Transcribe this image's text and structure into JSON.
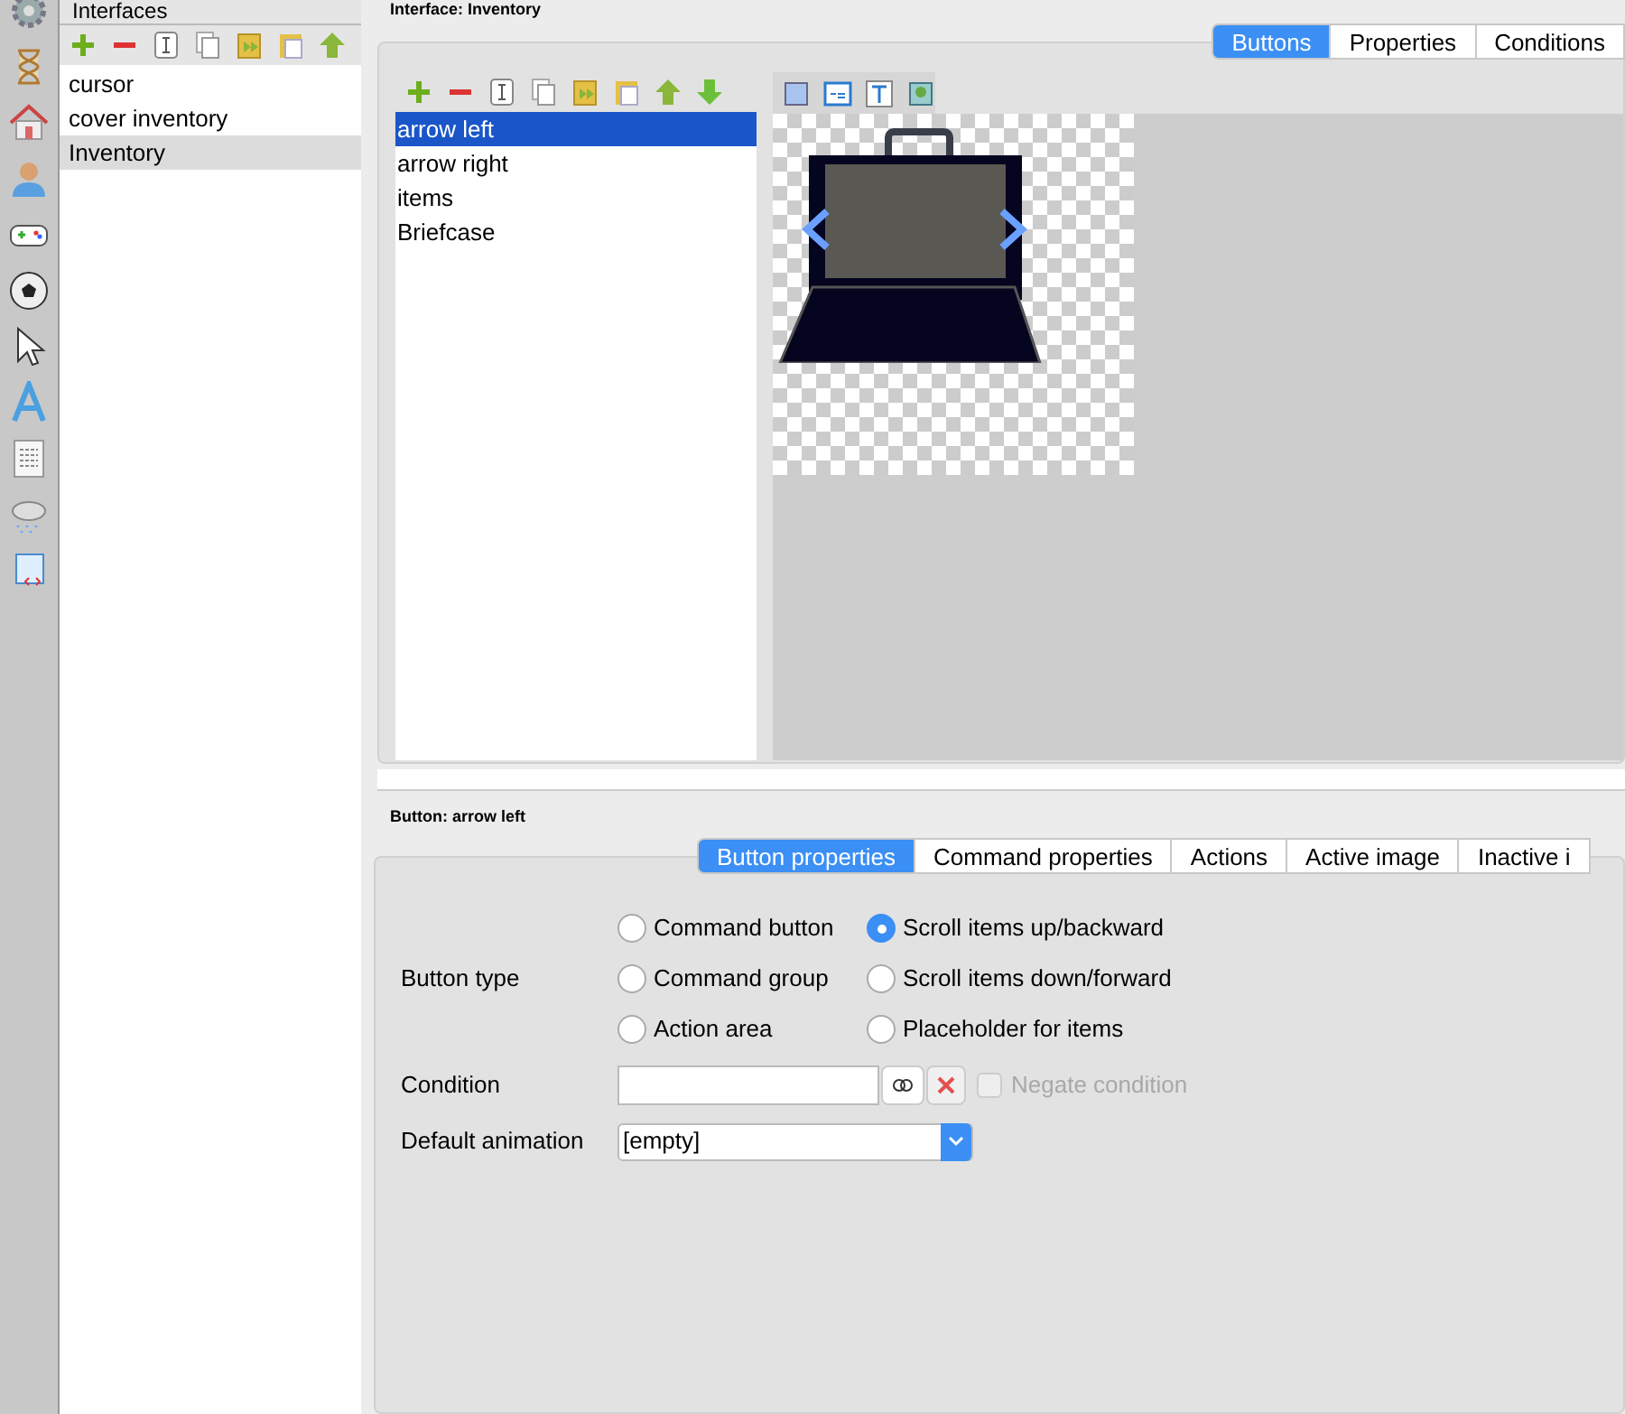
{
  "interfaces": {
    "title": "Interfaces",
    "items": [
      {
        "label": "cursor",
        "selected": false
      },
      {
        "label": "cover inventory",
        "selected": false
      },
      {
        "label": "Inventory",
        "selected": true
      }
    ]
  },
  "interface_title": "Interface: Inventory",
  "main_tabs": [
    {
      "label": "Buttons",
      "selected": true
    },
    {
      "label": "Properties",
      "selected": false
    },
    {
      "label": "Conditions",
      "selected": false
    }
  ],
  "buttons_list": [
    {
      "label": "arrow left",
      "selected": true
    },
    {
      "label": "arrow right",
      "selected": false
    },
    {
      "label": "items",
      "selected": false
    },
    {
      "label": "Briefcase",
      "selected": false
    }
  ],
  "button_title": "Button: arrow left",
  "property_tabs": [
    {
      "label": "Button properties",
      "selected": true
    },
    {
      "label": "Command properties",
      "selected": false
    },
    {
      "label": "Actions",
      "selected": false
    },
    {
      "label": "Active image",
      "selected": false
    },
    {
      "label": "Inactive i",
      "selected": false
    }
  ],
  "button_type": {
    "label": "Button type",
    "options": [
      {
        "label": "Command button",
        "selected": false
      },
      {
        "label": "Scroll items up/backward",
        "selected": true
      },
      {
        "label": "Command group",
        "selected": false
      },
      {
        "label": "Scroll items down/forward",
        "selected": false
      },
      {
        "label": "Action area",
        "selected": false
      },
      {
        "label": "Placeholder for items",
        "selected": false
      }
    ]
  },
  "condition": {
    "label": "Condition",
    "negate": {
      "label": "Negate condition",
      "checked": false,
      "disabled": true
    }
  },
  "default_animation": {
    "label": "Default animation",
    "value": "[empty]"
  }
}
